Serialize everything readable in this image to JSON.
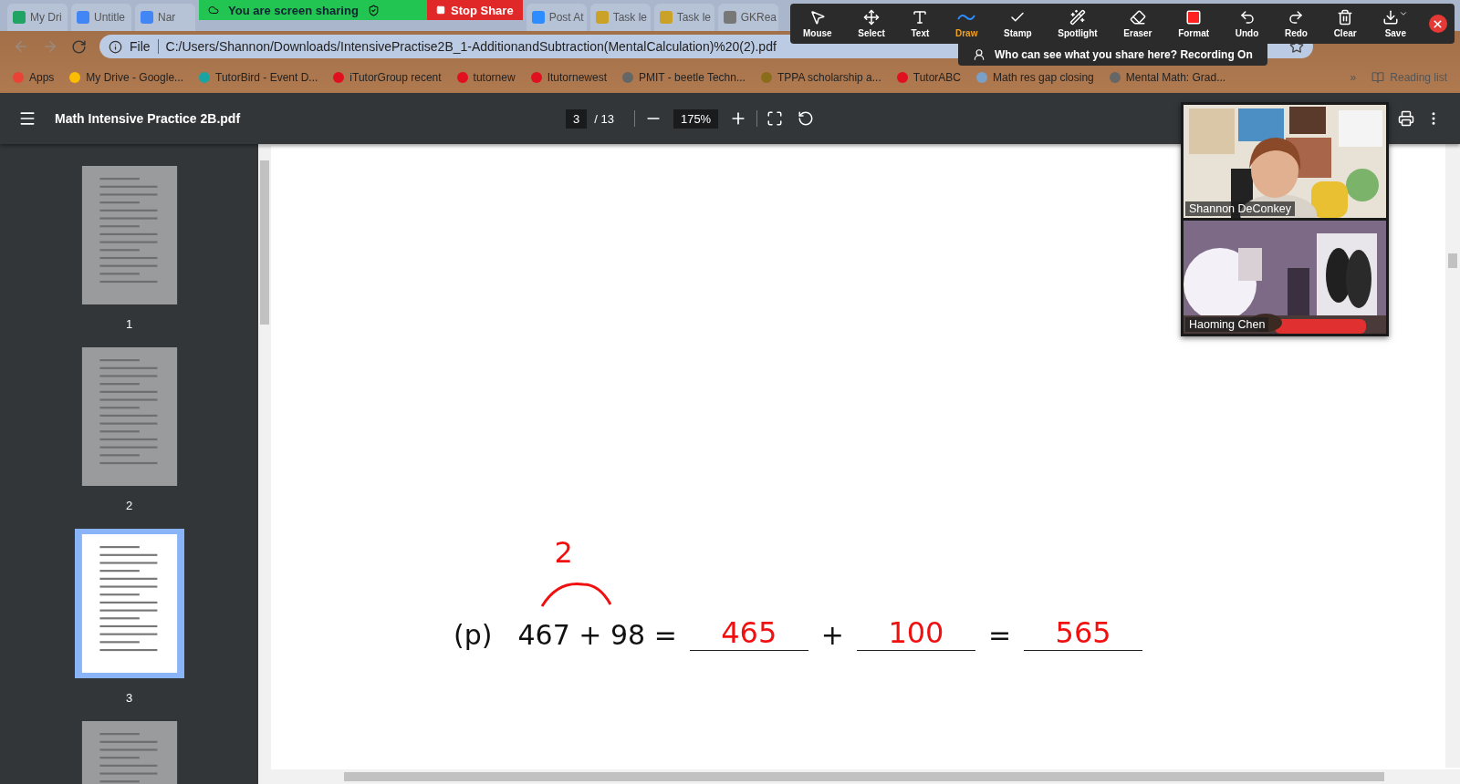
{
  "browser": {
    "tabs": [
      {
        "title": "My Dri",
        "color": "#1fa463"
      },
      {
        "title": "Untitle",
        "color": "#4285f4"
      },
      {
        "title": "Nar",
        "color": "#4285f4"
      },
      {
        "title": "Post At",
        "color": "#2d8cff"
      },
      {
        "title": "Task le",
        "color": "#c9a227"
      },
      {
        "title": "Task le",
        "color": "#c9a227"
      },
      {
        "title": "GKRea",
        "color": "#777777"
      }
    ],
    "address": {
      "scheme": "File",
      "url": "C:/Users/Shannon/Downloads/IntensivePractise2B_1-AdditionandSubtraction(MentalCalculation)%20(2).pdf"
    },
    "bookmarks": [
      {
        "title": "Apps",
        "color": "#ea4335"
      },
      {
        "title": "My Drive - Google...",
        "color": "#fbbc04"
      },
      {
        "title": "TutorBird - Event D...",
        "color": "#1aa3a3"
      },
      {
        "title": "iTutorGroup recent",
        "color": "#e01020"
      },
      {
        "title": "tutornew",
        "color": "#e01020"
      },
      {
        "title": "Itutornewest",
        "color": "#e01020"
      },
      {
        "title": "PMIT - beetle Techn...",
        "color": "#666666"
      },
      {
        "title": "TPPA scholarship a...",
        "color": "#8a6d1a"
      },
      {
        "title": "TutorABC",
        "color": "#e01020"
      },
      {
        "title": "Math res gap closing",
        "color": "#7aa0c8"
      },
      {
        "title": "Mental Math: Grad...",
        "color": "#666666"
      }
    ],
    "overflow": "»",
    "reading_list": "Reading list"
  },
  "share_banner": {
    "message": "You are screen sharing",
    "button": "Stop Share"
  },
  "annotation_toolbar": {
    "tools": [
      {
        "label": "Mouse",
        "kind": "mouse",
        "selected": false
      },
      {
        "label": "Select",
        "kind": "select",
        "selected": false
      },
      {
        "label": "Text",
        "kind": "text",
        "selected": false
      },
      {
        "label": "Draw",
        "kind": "draw",
        "selected": true
      },
      {
        "label": "Stamp",
        "kind": "stamp",
        "selected": false
      },
      {
        "label": "Spotlight",
        "kind": "spotlight",
        "selected": false
      },
      {
        "label": "Eraser",
        "kind": "eraser",
        "selected": false
      },
      {
        "label": "Format",
        "kind": "format",
        "selected": false
      },
      {
        "label": "Undo",
        "kind": "undo",
        "selected": false
      },
      {
        "label": "Redo",
        "kind": "redo",
        "selected": false
      },
      {
        "label": "Clear",
        "kind": "clear",
        "selected": false
      },
      {
        "label": "Save",
        "kind": "save",
        "selected": false
      }
    ],
    "notice": "Who can see what you share here? Recording On"
  },
  "pdf_viewer": {
    "title": "Math Intensive Practice 2B.pdf",
    "page": "3",
    "page_count": "/ 13",
    "zoom": "175%",
    "thumbnails": [
      {
        "label": "1",
        "selected": false
      },
      {
        "label": "2",
        "selected": false
      },
      {
        "label": "3",
        "selected": true
      },
      {
        "selected": false
      }
    ],
    "exercise": {
      "note": "2",
      "items": [
        {
          "kind": "label",
          "text": "(p)"
        },
        {
          "kind": "expression",
          "text": "467 + 98 ="
        },
        {
          "kind": "answer",
          "text": "465"
        },
        {
          "kind": "operator",
          "text": "+"
        },
        {
          "kind": "answer",
          "text": "100"
        },
        {
          "kind": "operator",
          "text": "="
        },
        {
          "kind": "answer",
          "text": "565"
        }
      ]
    }
  },
  "video_tiles": [
    {
      "name": "Shannon DeConkey",
      "kind": "picture"
    },
    {
      "name": "Haoming Chen",
      "kind": "picture"
    }
  ]
}
